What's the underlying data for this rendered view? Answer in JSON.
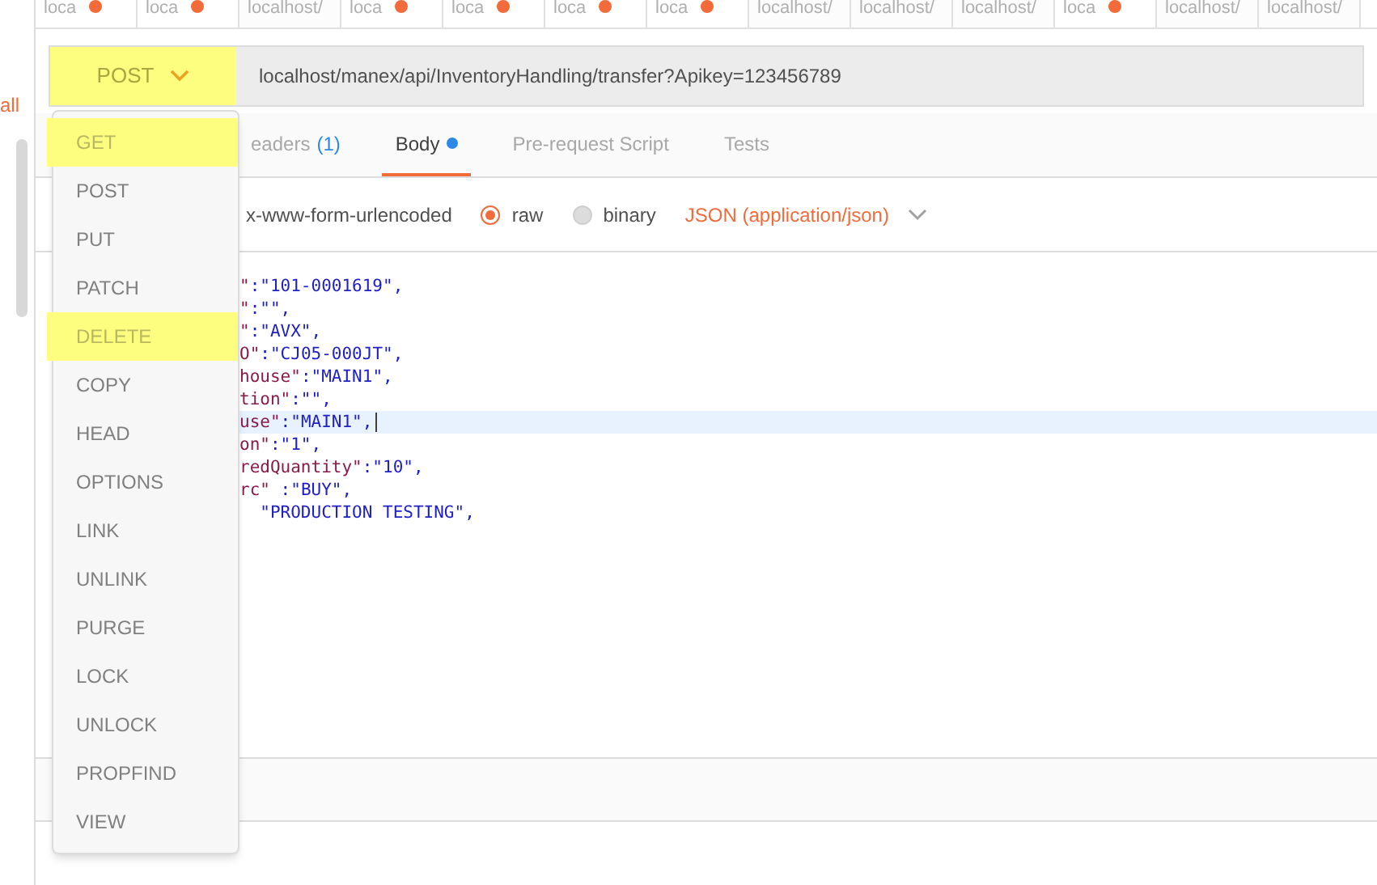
{
  "sidebar": {
    "link": "all"
  },
  "request_tabs": [
    {
      "label": "loca",
      "unsaved": true
    },
    {
      "label": "loca",
      "unsaved": true
    },
    {
      "label": "localhost/",
      "unsaved": false
    },
    {
      "label": "loca",
      "unsaved": true
    },
    {
      "label": "loca",
      "unsaved": true
    },
    {
      "label": "loca",
      "unsaved": true
    },
    {
      "label": "loca",
      "unsaved": true
    },
    {
      "label": "localhost/",
      "unsaved": false
    },
    {
      "label": "localhost/",
      "unsaved": false
    },
    {
      "label": "localhost/",
      "unsaved": false
    },
    {
      "label": "loca",
      "unsaved": true
    },
    {
      "label": "localhost/",
      "unsaved": false
    },
    {
      "label": "localhost/",
      "unsaved": false
    }
  ],
  "method": {
    "label": "POST",
    "highlighted": true
  },
  "url": "localhost/manex/api/InventoryHandling/transfer?Apikey=123456789",
  "tabs": [
    {
      "label": "eaders",
      "count": "(1)",
      "dot": false,
      "selected": false
    },
    {
      "label": "Body",
      "dot": true,
      "selected": true
    },
    {
      "label": "Pre-request Script",
      "dot": false,
      "selected": false
    },
    {
      "label": "Tests",
      "dot": false,
      "selected": false
    }
  ],
  "body_modes": [
    {
      "label": "x-www-form-urlencoded",
      "kind": "plain"
    },
    {
      "label": "raw",
      "kind": "radio",
      "selected": true
    },
    {
      "label": "binary",
      "kind": "radio",
      "selected": false
    }
  ],
  "content_type": "JSON (application/json)",
  "code_lines": [
    {
      "key": "\"",
      "value": ":\"101-0001619\",",
      "current": false
    },
    {
      "key": "\"",
      "value": ":\"\",",
      "current": false
    },
    {
      "key": "\"",
      "value": ":\"AVX\",",
      "current": false
    },
    {
      "key": "O\"",
      "value": ":\"CJ05-000JT\",",
      "current": false
    },
    {
      "key": "house\"",
      "value": ":\"MAIN1\",",
      "current": false
    },
    {
      "key": "tion\"",
      "value": ":\"\",",
      "current": false
    },
    {
      "key": "use\"",
      "value": ":\"MAIN1\",",
      "current": true
    },
    {
      "key": "on\"",
      "value": ":\"1\",",
      "current": false
    },
    {
      "key": "redQuantity\"",
      "value": ":\"10\",",
      "current": false
    },
    {
      "key": "rc\" ",
      "value": ":\"BUY\",",
      "current": false
    },
    {
      "value": "  \"PRODUCTION TESTING\",",
      "current": false
    }
  ],
  "method_menu": [
    {
      "label": "GET",
      "highlighted": true
    },
    {
      "label": "POST",
      "highlighted": false
    },
    {
      "label": "PUT",
      "highlighted": false
    },
    {
      "label": "PATCH",
      "highlighted": false
    },
    {
      "label": "DELETE",
      "highlighted": true
    },
    {
      "label": "COPY",
      "highlighted": false
    },
    {
      "label": "HEAD",
      "highlighted": false
    },
    {
      "label": "OPTIONS",
      "highlighted": false
    },
    {
      "label": "LINK",
      "highlighted": false
    },
    {
      "label": "UNLINK",
      "highlighted": false
    },
    {
      "label": "PURGE",
      "highlighted": false
    },
    {
      "label": "LOCK",
      "highlighted": false
    },
    {
      "label": "UNLOCK",
      "highlighted": false
    },
    {
      "label": "PROPFIND",
      "highlighted": false
    },
    {
      "label": "VIEW",
      "highlighted": false
    }
  ]
}
